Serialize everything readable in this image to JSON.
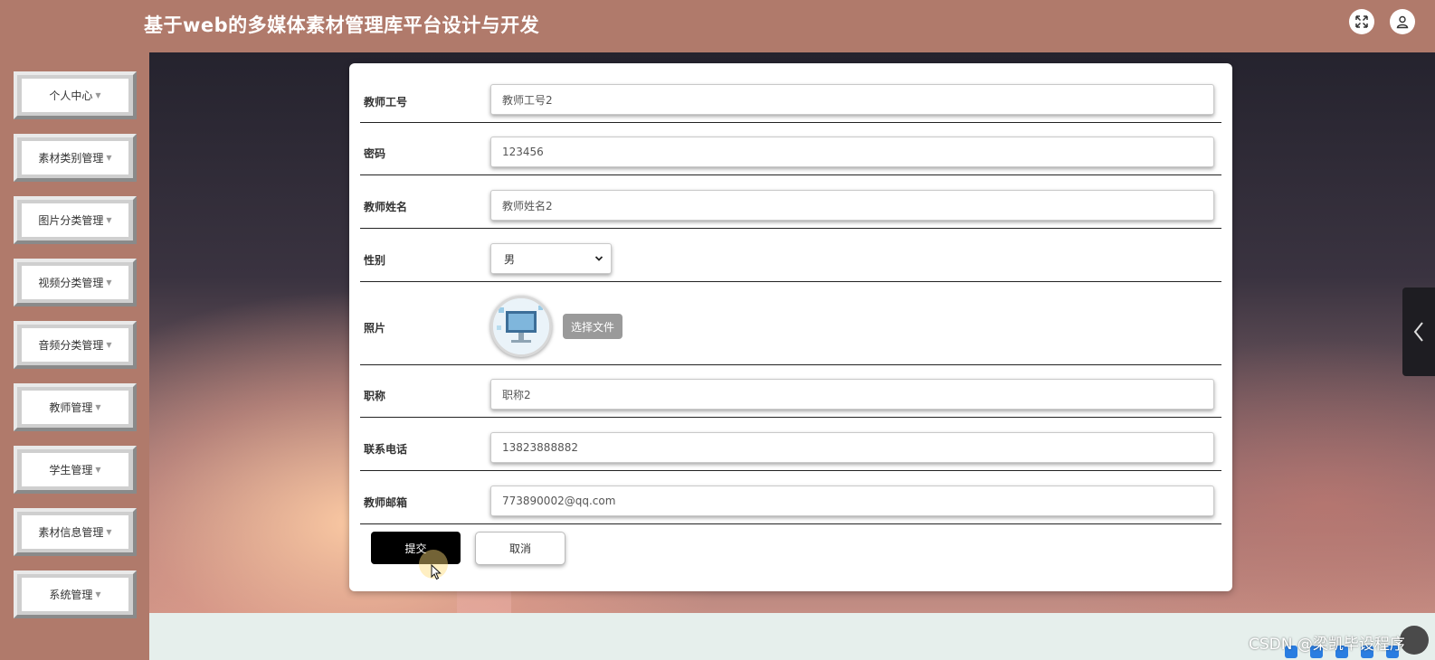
{
  "header": {
    "title": "基于web的多媒体素材管理库平台设计与开发",
    "fullscreen_icon": "expand-icon",
    "user_icon": "user-icon"
  },
  "sidebar": {
    "items": [
      {
        "label": "个人中心"
      },
      {
        "label": "素材类别管理"
      },
      {
        "label": "图片分类管理"
      },
      {
        "label": "视频分类管理"
      },
      {
        "label": "音频分类管理"
      },
      {
        "label": "教师管理"
      },
      {
        "label": "学生管理"
      },
      {
        "label": "素材信息管理"
      },
      {
        "label": "系统管理"
      }
    ]
  },
  "form": {
    "teacher_id": {
      "label": "教师工号",
      "value": "教师工号2"
    },
    "password": {
      "label": "密码",
      "value": "123456"
    },
    "teacher_name": {
      "label": "教师姓名",
      "value": "教师姓名2"
    },
    "gender": {
      "label": "性别",
      "value": "男"
    },
    "photo": {
      "label": "照片",
      "choose_file": "选择文件"
    },
    "title": {
      "label": "职称",
      "value": "职称2"
    },
    "phone": {
      "label": "联系电话",
      "value": "13823888882"
    },
    "email": {
      "label": "教师邮箱",
      "value": "773890002@qq.com"
    },
    "submit": "提交",
    "cancel": "取消"
  },
  "watermark": "CSDN @梁凯毕设程序",
  "colors": {
    "topbar": "#b07a6b",
    "submit_bg": "#000000",
    "file_button": "#9a9a9a"
  }
}
